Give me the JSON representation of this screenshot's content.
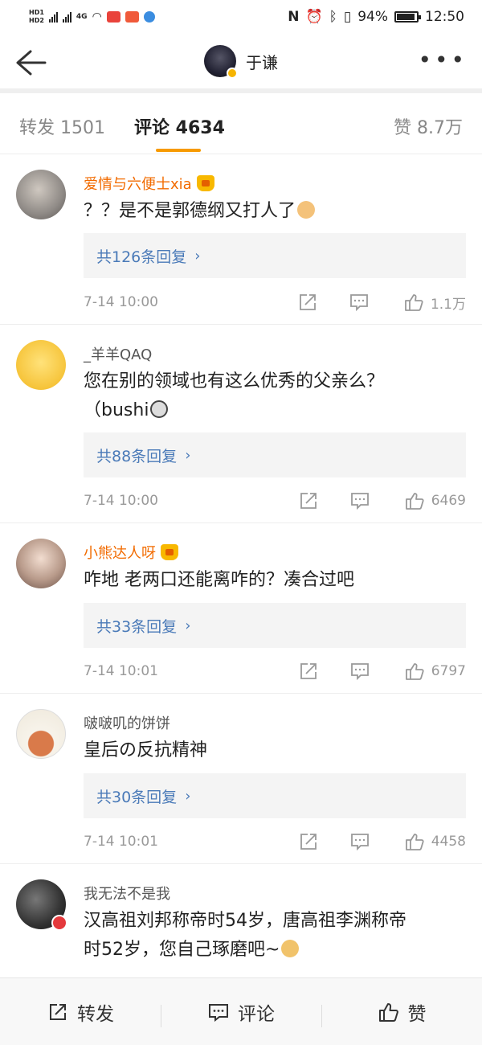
{
  "status": {
    "battery": "94%",
    "time": "12:50",
    "network": "4G"
  },
  "nav": {
    "username": "于谦"
  },
  "tabs": {
    "repost": "转发 1501",
    "comments": "评论 4634",
    "likes": "赞 8.7万"
  },
  "comments": [
    {
      "user": "爱情与六便士xia",
      "vip": true,
      "text": "？？是不是郭德纲又打人了",
      "replies": "共126条回复",
      "time": "7-14 10:00",
      "likes": "1.1万"
    },
    {
      "user": "_羊羊QAQ",
      "vip": false,
      "text": "您在别的领域也有这么优秀的父亲么？",
      "text2": "（bushi",
      "replies": "共88条回复",
      "time": "7-14 10:00",
      "likes": "6469"
    },
    {
      "user": "小熊达人呀",
      "vip": true,
      "text": "咋地 老两口还能离咋的？凑合过吧",
      "replies": "共33条回复",
      "time": "7-14 10:01",
      "likes": "6797"
    },
    {
      "user": "啵啵叽的饼饼",
      "vip": false,
      "text": "皇后の反抗精神",
      "replies": "共30条回复",
      "time": "7-14 10:01",
      "likes": "4458"
    },
    {
      "user": "我无法不是我",
      "vip": false,
      "text": "汉高祖刘邦称帝时54岁，唐高祖李渊称帝",
      "text2": "时52岁，您自己琢磨吧~"
    }
  ],
  "bottom": {
    "repost": "转发",
    "comment": "评论",
    "like": "赞"
  },
  "colors": {
    "accent": "#f79a00",
    "vip_name": "#f26b00",
    "reply_link": "#4a7ab8"
  }
}
